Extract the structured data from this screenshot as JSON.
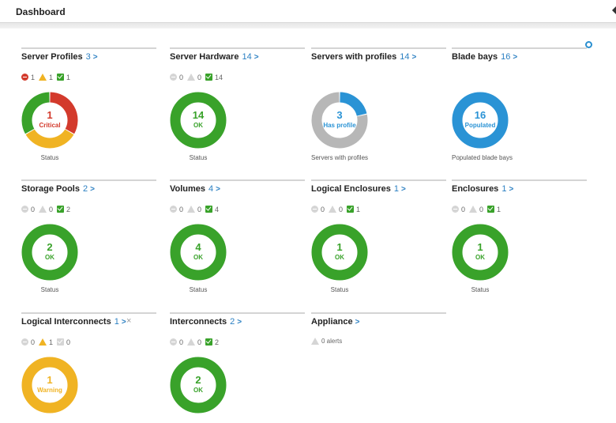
{
  "header": {
    "title": "Dashboard"
  },
  "colors": {
    "critical": "#d33a2c",
    "warning": "#f0b323",
    "ok": "#39a22a",
    "info": "#2a93d5",
    "neutral": "#b7b7b7"
  },
  "panels": [
    {
      "name": "Server Profiles",
      "count": "3",
      "arrow": ">",
      "statuses": [
        {
          "type": "critical",
          "active": true,
          "value": "1"
        },
        {
          "type": "warning",
          "active": true,
          "value": "1"
        },
        {
          "type": "ok",
          "active": true,
          "value": "1"
        }
      ],
      "donut": {
        "number": "1",
        "label": "Critical",
        "text_color": "#d33a2c",
        "segments": [
          {
            "color": "#d33a2c",
            "value": 1
          },
          {
            "color": "#f0b323",
            "value": 1
          },
          {
            "color": "#39a22a",
            "value": 1
          }
        ]
      },
      "caption": "Status"
    },
    {
      "name": "Server Hardware",
      "count": "14",
      "arrow": ">",
      "statuses": [
        {
          "type": "critical",
          "active": false,
          "value": "0"
        },
        {
          "type": "warning",
          "active": false,
          "value": "0"
        },
        {
          "type": "ok",
          "active": true,
          "value": "14"
        }
      ],
      "donut": {
        "number": "14",
        "label": "OK",
        "text_color": "#39a22a",
        "segments": [
          {
            "color": "#39a22a",
            "value": 14
          }
        ]
      },
      "caption": "Status"
    },
    {
      "name": "Servers with profiles",
      "count": "14",
      "arrow": ">",
      "statuses": [],
      "donut": {
        "number": "3",
        "label": "Has profile",
        "text_color": "#2a93d5",
        "segments": [
          {
            "color": "#2a93d5",
            "value": 3
          },
          {
            "color": "#b7b7b7",
            "value": 11
          }
        ]
      },
      "caption": "Servers with profiles"
    },
    {
      "name": "Blade bays",
      "count": "16",
      "arrow": ">",
      "statuses": [],
      "donut": {
        "number": "16",
        "label": "Populated",
        "text_color": "#2a93d5",
        "segments": [
          {
            "color": "#2a93d5",
            "value": 16
          }
        ]
      },
      "caption": "Populated blade bays"
    },
    {
      "name": "Storage Pools",
      "count": "2",
      "arrow": ">",
      "statuses": [
        {
          "type": "critical",
          "active": false,
          "value": "0"
        },
        {
          "type": "warning",
          "active": false,
          "value": "0"
        },
        {
          "type": "ok",
          "active": true,
          "value": "2"
        }
      ],
      "donut": {
        "number": "2",
        "label": "OK",
        "text_color": "#39a22a",
        "segments": [
          {
            "color": "#39a22a",
            "value": 2
          }
        ]
      },
      "caption": "Status"
    },
    {
      "name": "Volumes",
      "count": "4",
      "arrow": ">",
      "statuses": [
        {
          "type": "critical",
          "active": false,
          "value": "0"
        },
        {
          "type": "warning",
          "active": false,
          "value": "0"
        },
        {
          "type": "ok",
          "active": true,
          "value": "4"
        }
      ],
      "donut": {
        "number": "4",
        "label": "OK",
        "text_color": "#39a22a",
        "segments": [
          {
            "color": "#39a22a",
            "value": 4
          }
        ]
      },
      "caption": "Status"
    },
    {
      "name": "Logical Enclosures",
      "count": "1",
      "arrow": ">",
      "statuses": [
        {
          "type": "critical",
          "active": false,
          "value": "0"
        },
        {
          "type": "warning",
          "active": false,
          "value": "0"
        },
        {
          "type": "ok",
          "active": true,
          "value": "1"
        }
      ],
      "donut": {
        "number": "1",
        "label": "OK",
        "text_color": "#39a22a",
        "segments": [
          {
            "color": "#39a22a",
            "value": 1
          }
        ]
      },
      "caption": "Status"
    },
    {
      "name": "Enclosures",
      "count": "1",
      "arrow": ">",
      "statuses": [
        {
          "type": "critical",
          "active": false,
          "value": "0"
        },
        {
          "type": "warning",
          "active": false,
          "value": "0"
        },
        {
          "type": "ok",
          "active": true,
          "value": "1"
        }
      ],
      "donut": {
        "number": "1",
        "label": "OK",
        "text_color": "#39a22a",
        "segments": [
          {
            "color": "#39a22a",
            "value": 1
          }
        ]
      },
      "caption": "Status"
    },
    {
      "name": "Logical Interconnects",
      "count": "1",
      "arrow": ">",
      "close": "×",
      "statuses": [
        {
          "type": "critical",
          "active": false,
          "value": "0"
        },
        {
          "type": "warning",
          "active": true,
          "value": "1"
        },
        {
          "type": "ok",
          "active": false,
          "value": "0"
        }
      ],
      "donut": {
        "number": "1",
        "label": "Warning",
        "text_color": "#f0b323",
        "segments": [
          {
            "color": "#f0b323",
            "value": 1
          }
        ]
      },
      "caption": ""
    },
    {
      "name": "Interconnects",
      "count": "2",
      "arrow": ">",
      "statuses": [
        {
          "type": "critical",
          "active": false,
          "value": "0"
        },
        {
          "type": "warning",
          "active": false,
          "value": "0"
        },
        {
          "type": "ok",
          "active": true,
          "value": "2"
        }
      ],
      "donut": {
        "number": "2",
        "label": "OK",
        "text_color": "#39a22a",
        "segments": [
          {
            "color": "#39a22a",
            "value": 2
          }
        ]
      },
      "caption": ""
    },
    {
      "name": "Appliance",
      "count": "",
      "arrow": ">",
      "statuses": [],
      "alerts": "0 alerts",
      "donut": null,
      "caption": ""
    }
  ]
}
